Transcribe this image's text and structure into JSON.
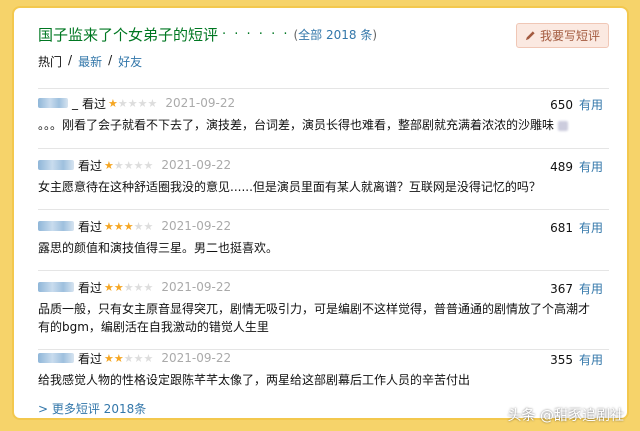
{
  "header": {
    "title": "国子监来了个女弟子的短评",
    "dots": "· · · · · ·",
    "count_open": "(",
    "count_text": "全部 2018 条",
    "count_close": ")",
    "write_button": "我要写短评"
  },
  "tabs": [
    {
      "label": "热门",
      "sep": "/"
    },
    {
      "label": "最新",
      "sep": "/"
    },
    {
      "label": "好友",
      "sep": ""
    }
  ],
  "reviews": [
    {
      "user_prefix": "_",
      "status": "看过",
      "rating": 1,
      "date": "2021-09-22",
      "useful_count": "650",
      "useful_label": "有用",
      "content": "。。。刚看了会子就看不下去了，演技差，台词差，演员长得也难看，整部剧就充满着浓浓的沙雕味"
    },
    {
      "user_prefix": "",
      "status": "看过",
      "rating": 1,
      "date": "2021-09-22",
      "useful_count": "489",
      "useful_label": "有用",
      "content": "女主愿意待在这种舒适圈我没的意见......但是演员里面有某人就离谱？互联网是没得记忆的吗？"
    },
    {
      "user_prefix": "",
      "status": "看过",
      "rating": 3,
      "date": "2021-09-22",
      "useful_count": "681",
      "useful_label": "有用",
      "content": "露思的颜值和演技值得三星。男二也挺喜欢。"
    },
    {
      "user_prefix": "",
      "status": "看过",
      "rating": 2,
      "date": "2021-09-22",
      "useful_count": "367",
      "useful_label": "有用",
      "content": "品质一般，只有女主原音显得突兀，剧情无吸引力，可是编剧不这样觉得，普普通通的剧情放了个高潮才有的bgm，编剧活在自我激动的错觉人生里"
    },
    {
      "user_prefix": "",
      "status": "看过",
      "rating": 2,
      "date": "2021-09-22",
      "useful_count": "355",
      "useful_label": "有用",
      "content": "给我感觉人物的性格设定跟陈芊芊太像了，两星给这部剧幕后工作人员的辛苦付出"
    }
  ],
  "more_link": "> 更多短评 2018条",
  "watermark": "头条 @甜豕追剧社",
  "colors": {
    "accent_green": "#007722",
    "link_blue": "#3377aa",
    "star": "#f5a623",
    "border": "#f3c84e"
  }
}
